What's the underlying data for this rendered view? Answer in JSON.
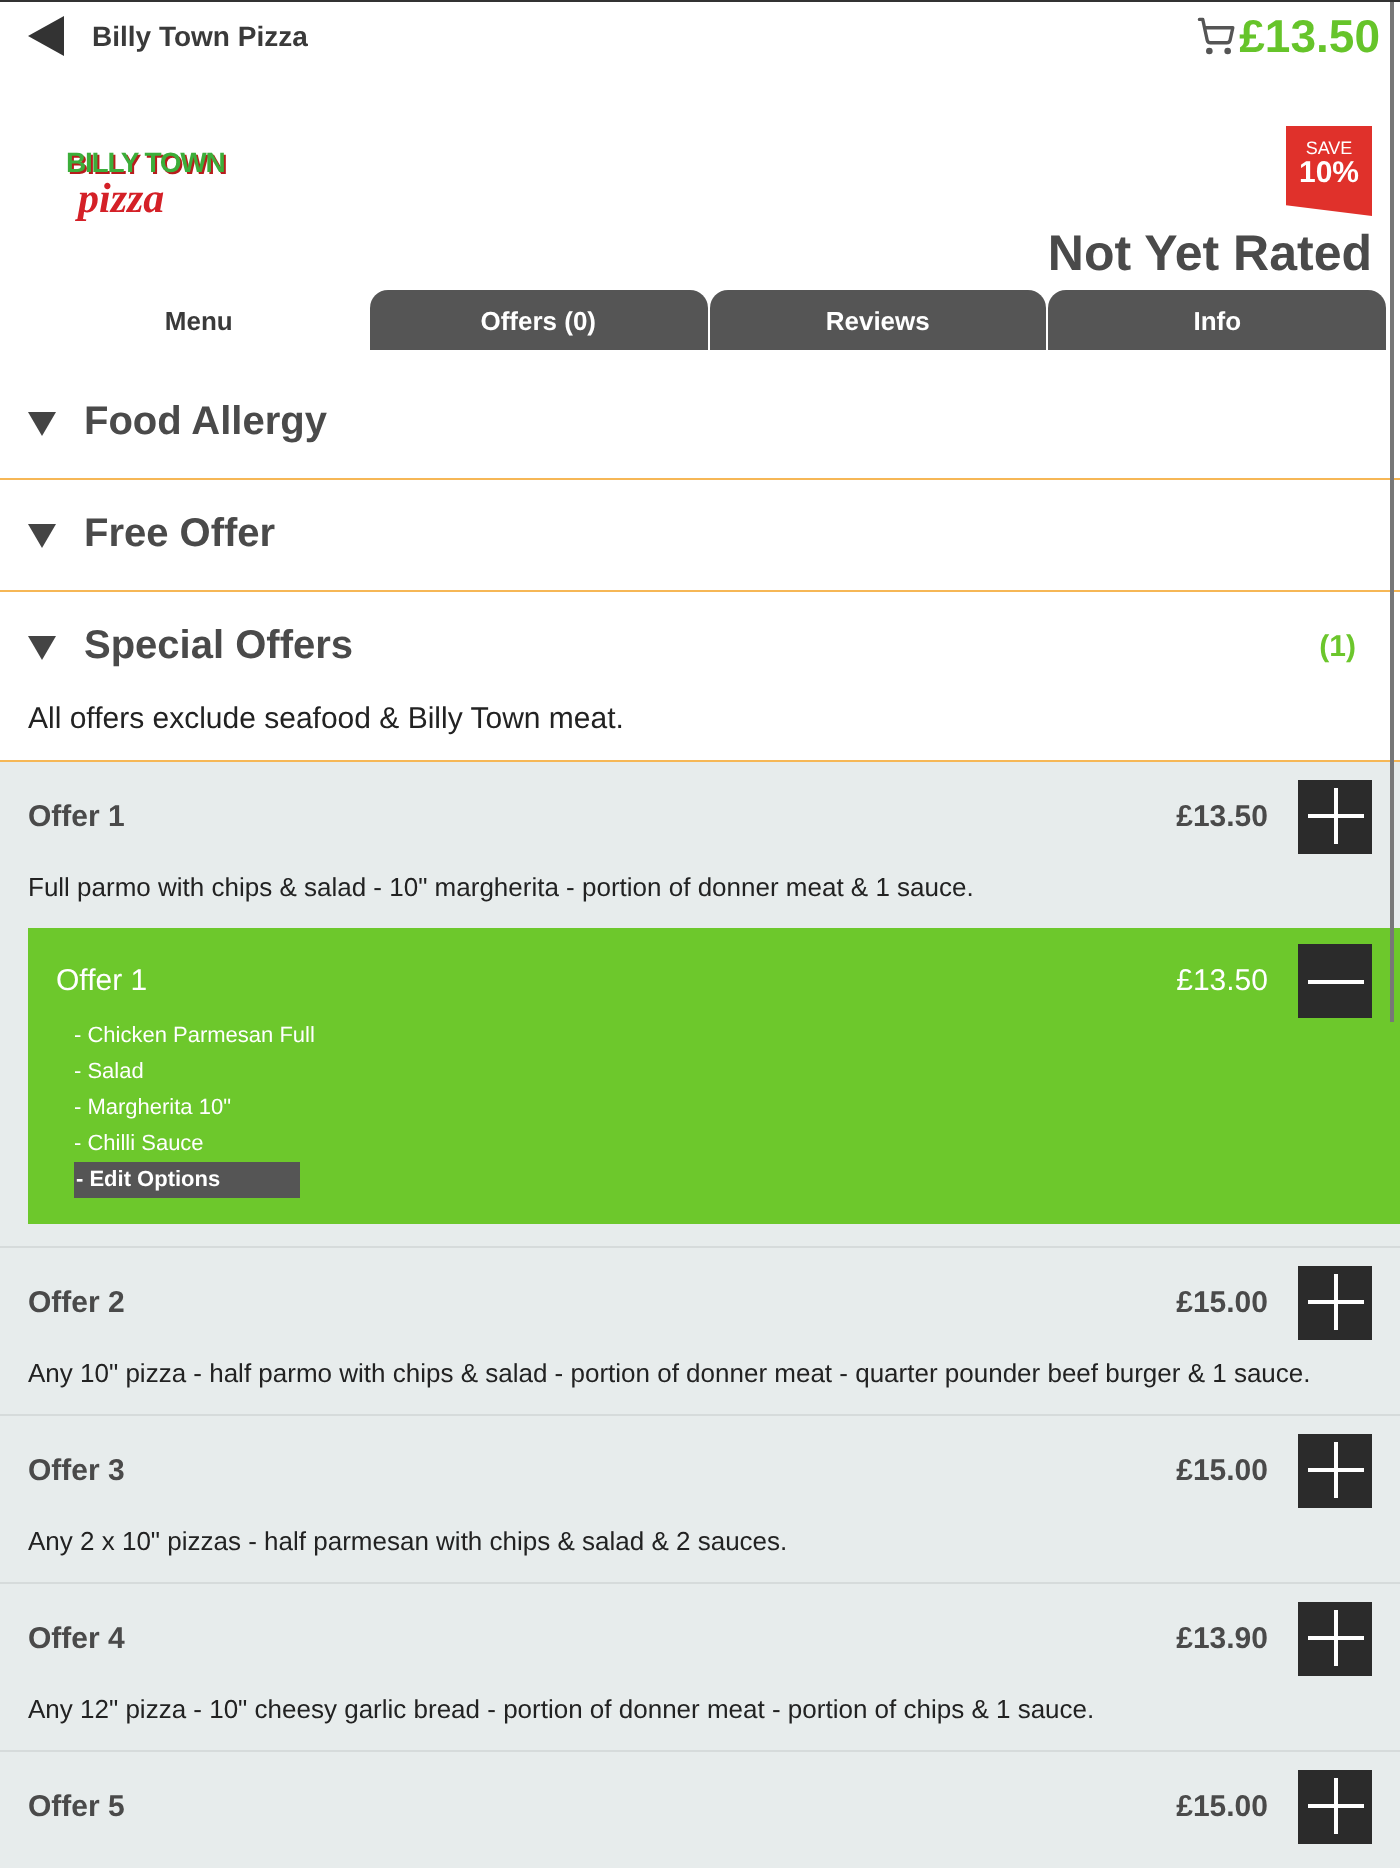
{
  "header": {
    "title": "Billy Town Pizza",
    "cart_total": "£13.50"
  },
  "restaurant": {
    "logo": {
      "line_1": "BILLY TOWN",
      "line_2": "pizza"
    },
    "ribbon": {
      "label": "SAVE",
      "value": "10%"
    },
    "rating": "Not Yet Rated"
  },
  "tabs": [
    {
      "label": "Menu",
      "selected": true
    },
    {
      "label": "Offers (0)",
      "selected": false
    },
    {
      "label": "Reviews",
      "selected": false
    },
    {
      "label": "Info",
      "selected": false
    }
  ],
  "sections": [
    {
      "title": "Food Allergy"
    },
    {
      "title": "Free Offer"
    },
    {
      "title": "Special Offers",
      "count": "(1)",
      "note": "All offers exclude seafood & Billy Town meat."
    }
  ],
  "offers": [
    {
      "title": "Offer 1",
      "price": "£13.50",
      "description": "Full parmo with chips & salad - 10\" margherita - portion of donner meat & 1 sauce.",
      "added": [
        {
          "title": "Offer 1",
          "price": "£13.50",
          "options": [
            "- Chicken Parmesan Full",
            "- Salad",
            "- Margherita 10\"",
            "- Chilli Sauce"
          ],
          "edit_label": "- Edit Options"
        }
      ]
    },
    {
      "title": "Offer 2",
      "price": "£15.00",
      "description": "Any 10\" pizza - half parmo with chips & salad - portion of donner meat - quarter pounder beef burger & 1 sauce."
    },
    {
      "title": "Offer 3",
      "price": "£15.00",
      "description": "Any 2 x 10\" pizzas - half parmesan with chips & salad & 2 sauces."
    },
    {
      "title": "Offer 4",
      "price": "£13.90",
      "description": "Any 12\" pizza - 10\" cheesy garlic bread - portion of donner meat - portion of chips & 1 sauce."
    },
    {
      "title": "Offer 5",
      "price": "£15.00"
    }
  ]
}
